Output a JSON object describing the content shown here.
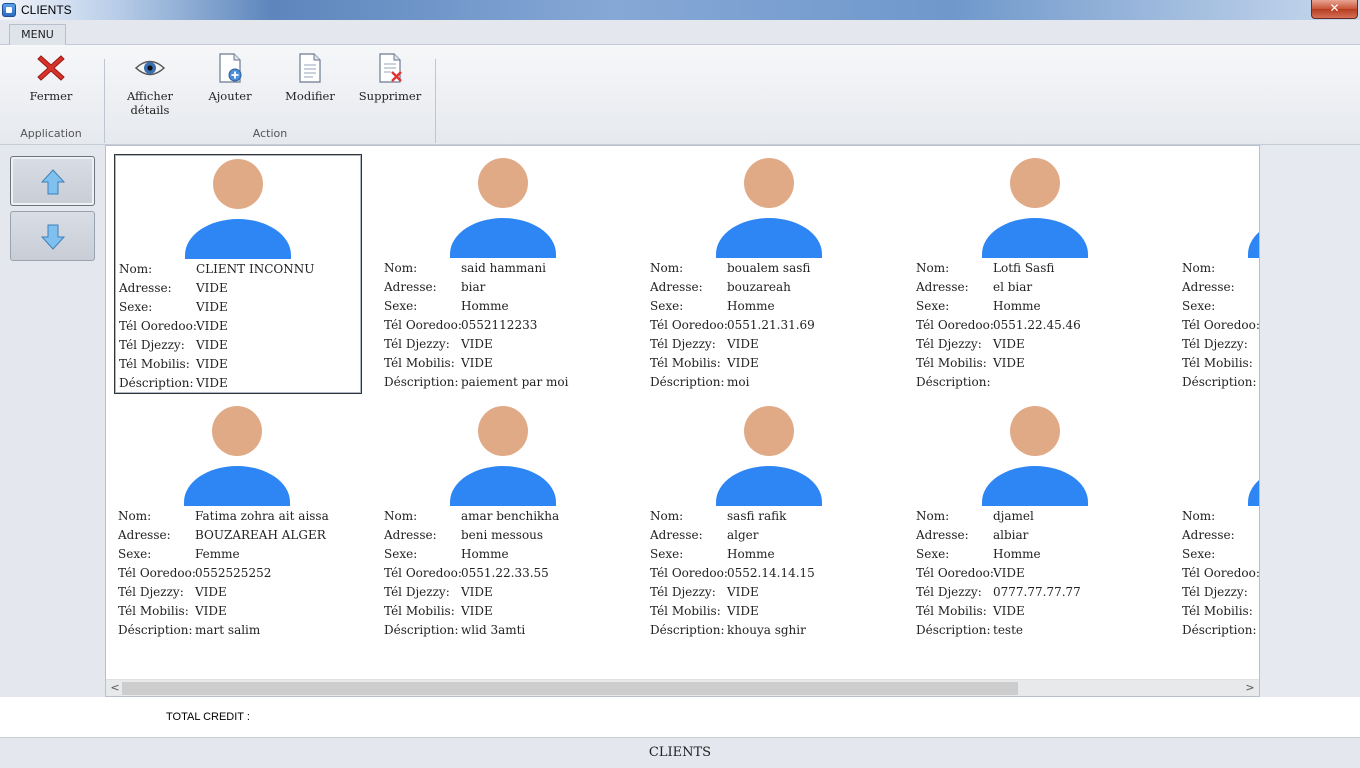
{
  "window": {
    "title": "CLIENTS",
    "close_glyph": "✕"
  },
  "menu": {
    "tab_label": "MENU"
  },
  "ribbon": {
    "groups": [
      {
        "label": "Application",
        "buttons": [
          {
            "label": "Fermer",
            "icon": "close-x-icon"
          }
        ]
      },
      {
        "label": "Action",
        "buttons": [
          {
            "label": "Afficher\ndétails",
            "icon": "eye-icon"
          },
          {
            "label": "Ajouter",
            "icon": "document-add-icon"
          },
          {
            "label": "Modifier",
            "icon": "document-edit-icon"
          },
          {
            "label": "Supprimer",
            "icon": "document-delete-icon"
          }
        ]
      }
    ]
  },
  "nav": {
    "up_icon": "arrow-up-icon",
    "down_icon": "arrow-down-icon"
  },
  "field_labels": {
    "nom": "Nom:",
    "adresse": "Adresse:",
    "sexe": "Sexe:",
    "ooredoo": "Tél Ooredoo:",
    "djezzy": "Tél Djezzy:",
    "mobilis": "Tél Mobilis:",
    "description": "Déscription:"
  },
  "clients": [
    {
      "nom": "CLIENT INCONNU",
      "adresse": "VIDE",
      "sexe": "VIDE",
      "ooredoo": "VIDE",
      "djezzy": "VIDE",
      "mobilis": "VIDE",
      "description": "VIDE",
      "selected": true
    },
    {
      "nom": "said hammani",
      "adresse": "biar",
      "sexe": "Homme",
      "ooredoo": "0552112233",
      "djezzy": "VIDE",
      "mobilis": "VIDE",
      "description": "paiement par moi"
    },
    {
      "nom": "boualem sasfi",
      "adresse": "bouzareah",
      "sexe": "Homme",
      "ooredoo": "0551.21.31.69",
      "djezzy": "VIDE",
      "mobilis": "VIDE",
      "description": "moi"
    },
    {
      "nom": "Lotfi Sasfi",
      "adresse": "el biar",
      "sexe": "Homme",
      "ooredoo": "0551.22.45.46",
      "djezzy": "VIDE",
      "mobilis": "VIDE",
      "description": ""
    },
    {
      "nom": "",
      "adresse": "",
      "sexe": "",
      "ooredoo": "",
      "djezzy": "",
      "mobilis": "",
      "description": ""
    },
    {
      "nom": "Fatima zohra ait aissa",
      "adresse": "BOUZAREAH ALGER",
      "sexe": "Femme",
      "ooredoo": "0552525252",
      "djezzy": "VIDE",
      "mobilis": "VIDE",
      "description": "mart salim"
    },
    {
      "nom": "amar benchikha",
      "adresse": "beni messous",
      "sexe": "Homme",
      "ooredoo": "0551.22.33.55",
      "djezzy": "VIDE",
      "mobilis": "VIDE",
      "description": "wlid 3amti"
    },
    {
      "nom": "sasfi rafik",
      "adresse": "alger",
      "sexe": "Homme",
      "ooredoo": "0552.14.14.15",
      "djezzy": "VIDE",
      "mobilis": "VIDE",
      "description": "khouya sghir"
    },
    {
      "nom": "djamel",
      "adresse": "albiar",
      "sexe": "Homme",
      "ooredoo": "VIDE",
      "djezzy": "0777.77.77.77",
      "mobilis": "VIDE",
      "description": "teste"
    },
    {
      "nom": "",
      "adresse": "",
      "sexe": "",
      "ooredoo": "",
      "djezzy": "",
      "mobilis": "",
      "description": ""
    }
  ],
  "scrollbar": {
    "left_arrow": "<",
    "right_arrow": ">"
  },
  "total": {
    "label": "TOTAL CREDIT :",
    "value": ""
  },
  "status": {
    "text": "CLIENTS"
  },
  "colors": {
    "avatar_head": "#e1aa86",
    "avatar_body": "#2d86f3",
    "close_button": "#c75437"
  }
}
